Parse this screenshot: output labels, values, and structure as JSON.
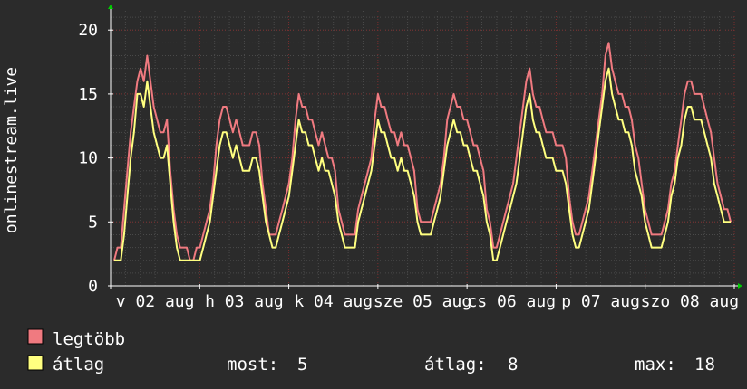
{
  "chart_data": {
    "type": "line",
    "ylabel": "onlinestream.live",
    "ylim": [
      0,
      21.5
    ],
    "yticks": [
      0,
      5,
      10,
      15,
      20
    ],
    "xtick_labels": [
      "v 02 aug",
      "h 03 aug",
      "k 04 aug",
      "sze 05 aug",
      "cs 06 aug",
      "p 07 aug",
      "szo 08 aug"
    ],
    "grid": true,
    "colors": {
      "background": "#2b2b2b",
      "plot_background": "#2b2b2b",
      "grid_major": "#7a2e2e",
      "grid_minor": "#4a4a4a",
      "axis": "#ffffff",
      "arrow": "#00cc00",
      "max_series": "#f07a80",
      "avg_series": "#ffff80"
    },
    "series": [
      {
        "name": "legtöbb",
        "color": "#f07a80",
        "values": [
          2,
          3,
          3,
          6,
          9,
          12,
          14,
          16,
          17,
          16,
          18,
          16,
          14,
          13,
          12,
          12,
          13,
          9,
          6,
          4,
          3,
          3,
          3,
          2,
          2,
          3,
          3,
          4,
          5,
          6,
          8,
          11,
          13,
          14,
          14,
          13,
          12,
          13,
          12,
          11,
          11,
          11,
          12,
          12,
          11,
          8,
          6,
          4,
          4,
          4,
          5,
          6,
          7,
          8,
          10,
          13,
          15,
          14,
          14,
          13,
          13,
          12,
          11,
          12,
          11,
          10,
          10,
          9,
          6,
          5,
          4,
          4,
          4,
          4,
          6,
          7,
          8,
          9,
          10,
          13,
          15,
          14,
          14,
          13,
          12,
          12,
          11,
          12,
          11,
          11,
          10,
          9,
          6,
          5,
          5,
          5,
          5,
          6,
          7,
          8,
          10,
          13,
          14,
          15,
          14,
          14,
          13,
          13,
          12,
          11,
          11,
          10,
          9,
          6,
          5,
          3,
          3,
          4,
          5,
          6,
          7,
          8,
          10,
          12,
          14,
          16,
          17,
          15,
          14,
          14,
          13,
          12,
          12,
          12,
          11,
          11,
          11,
          10,
          7,
          5,
          4,
          4,
          5,
          6,
          7,
          9,
          11,
          13,
          15,
          18,
          19,
          17,
          16,
          15,
          15,
          14,
          14,
          13,
          11,
          10,
          8,
          6,
          5,
          4,
          4,
          4,
          4,
          5,
          6,
          8,
          9,
          11,
          13,
          15,
          16,
          16,
          15,
          15,
          15,
          14,
          13,
          12,
          10,
          8,
          7,
          6,
          6,
          5
        ]
      },
      {
        "name": "átlag",
        "color": "#ffff80",
        "values": [
          2,
          2,
          2,
          4,
          7,
          10,
          12,
          15,
          15,
          14,
          16,
          14,
          12,
          11,
          10,
          10,
          11,
          8,
          5,
          3,
          2,
          2,
          2,
          2,
          2,
          2,
          2,
          3,
          4,
          5,
          7,
          9,
          11,
          12,
          12,
          11,
          10,
          11,
          10,
          9,
          9,
          9,
          10,
          10,
          9,
          7,
          5,
          4,
          3,
          3,
          4,
          5,
          6,
          7,
          9,
          11,
          13,
          12,
          12,
          11,
          11,
          10,
          9,
          10,
          9,
          9,
          8,
          7,
          5,
          4,
          3,
          3,
          3,
          3,
          5,
          6,
          7,
          8,
          9,
          11,
          13,
          12,
          12,
          11,
          10,
          10,
          9,
          10,
          9,
          9,
          8,
          7,
          5,
          4,
          4,
          4,
          4,
          5,
          6,
          7,
          9,
          11,
          12,
          13,
          12,
          12,
          11,
          11,
          10,
          9,
          9,
          8,
          7,
          5,
          4,
          2,
          2,
          3,
          4,
          5,
          6,
          7,
          8,
          10,
          12,
          14,
          15,
          13,
          12,
          12,
          11,
          10,
          10,
          10,
          9,
          9,
          9,
          8,
          6,
          4,
          3,
          3,
          4,
          5,
          6,
          8,
          10,
          12,
          14,
          16,
          17,
          15,
          14,
          13,
          13,
          12,
          12,
          11,
          9,
          8,
          7,
          5,
          4,
          3,
          3,
          3,
          3,
          4,
          5,
          7,
          8,
          10,
          11,
          13,
          14,
          14,
          13,
          13,
          13,
          12,
          11,
          10,
          8,
          7,
          6,
          5,
          5,
          5
        ]
      }
    ]
  },
  "legend": {
    "max_label": "legtöbb",
    "avg_label": "átlag",
    "current_label": "most:",
    "current_value": "5",
    "average_label": "átlag:",
    "average_value": "8",
    "maximum_label": "max:",
    "maximum_value": "18"
  }
}
